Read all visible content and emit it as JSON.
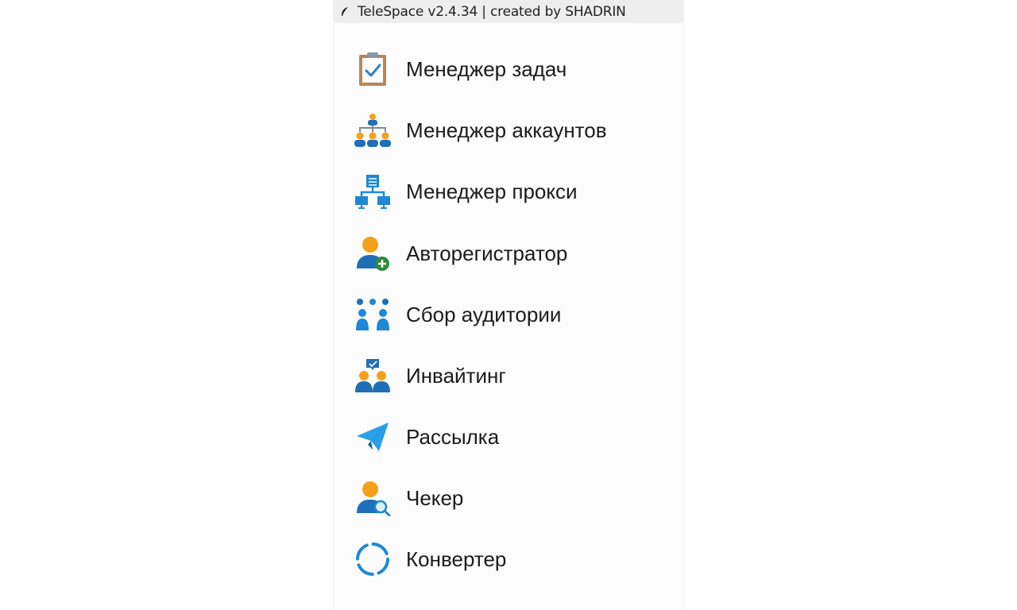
{
  "window": {
    "title": "TeleSpace v2.4.34 | created by SHADRIN",
    "app_icon": "feather-icon"
  },
  "menu": {
    "items": [
      {
        "label": "Менеджер задач",
        "icon": "clipboard-check-icon"
      },
      {
        "label": "Менеджер аккаунтов",
        "icon": "account-hierarchy-icon"
      },
      {
        "label": "Менеджер прокси",
        "icon": "network-servers-icon"
      },
      {
        "label": "Авторегистратор",
        "icon": "user-add-icon"
      },
      {
        "label": "Сбор аудитории",
        "icon": "audience-group-icon"
      },
      {
        "label": "Инвайтинг",
        "icon": "users-invite-icon"
      },
      {
        "label": "Рассылка",
        "icon": "paper-plane-icon"
      },
      {
        "label": "Чекер",
        "icon": "user-search-icon"
      },
      {
        "label": "Конвертер",
        "icon": "convert-circle-icon"
      }
    ]
  },
  "colors": {
    "titlebar_bg": "#edeeed",
    "window_bg": "#fcfcfc",
    "icon_blue": "#1e88d6",
    "icon_orange": "#f4a019",
    "icon_green": "#2e8b3e"
  }
}
